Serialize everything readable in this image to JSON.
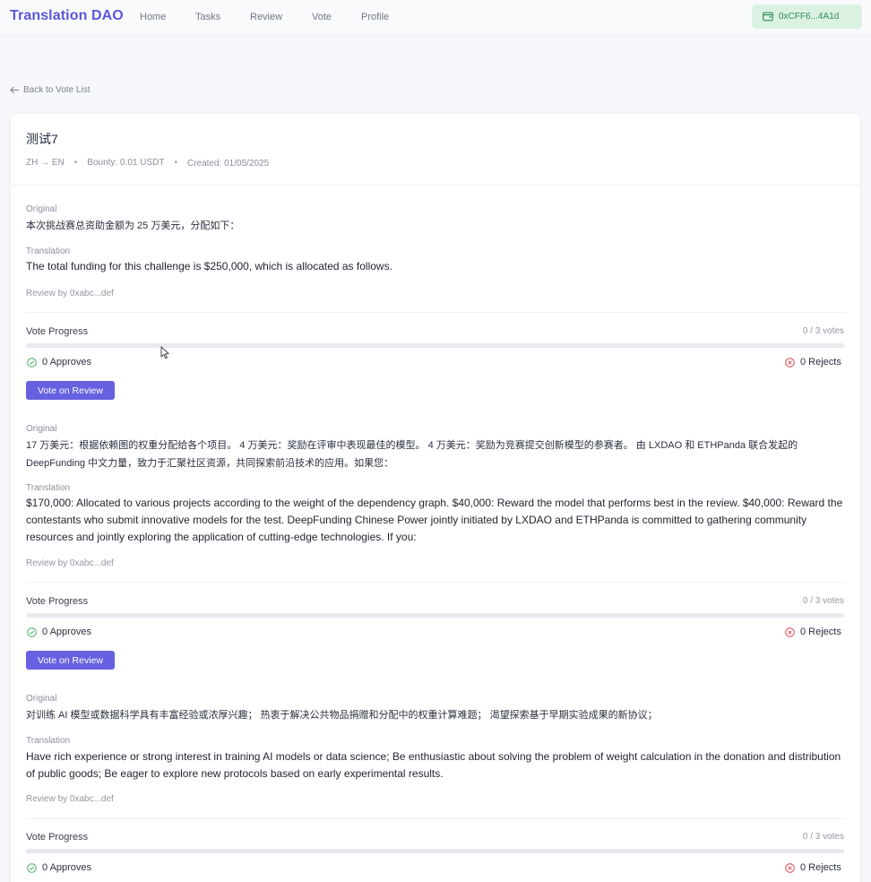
{
  "app": {
    "brand": "Translation DAO",
    "nav": [
      "Home",
      "Tasks",
      "Review",
      "Vote",
      "Profile"
    ],
    "wallet": "0xCFF6...4A1d",
    "wallet_icon": "wallet-icon",
    "colors": {
      "brand": "#5b57d9",
      "wallet_bg": "#dbf2e3",
      "wallet_text": "#2f8a53",
      "button": "#6661e0",
      "approve": "#4caf6e",
      "reject": "#e04a5a"
    }
  },
  "back": {
    "label": "Back to Vote List",
    "icon": "arrow-left-icon"
  },
  "task": {
    "title": "测试7",
    "lang": "ZH → EN",
    "bounty": "Bounty: 0.01 USDT",
    "created": "Created: 01/05/2025"
  },
  "labels": {
    "original": "Original",
    "translation": "Translation",
    "vote_progress": "Vote Progress",
    "vote_button": "Vote on Review"
  },
  "reviews": [
    {
      "original": "本次挑战赛总资助金额为 25 万美元，分配如下：",
      "translation": "The total funding for this challenge is $250,000, which is allocated as follows.",
      "reviewer": "Review by 0xabc...def",
      "votes": "0 / 3 votes",
      "progress": 0,
      "approves": "0 Approves",
      "rejects": "0 Rejects"
    },
    {
      "original": "17 万美元：根据依赖图的权重分配给各个项目。 4 万美元：奖励在评审中表现最佳的模型。 4 万美元：奖励为竞赛提交创新模型的参赛者。 由 LXDAO 和 ETHPanda 联合发起的 DeepFunding 中文力量，致力于汇聚社区资源，共同探索前沿技术的应用。如果您：",
      "translation": "$170,000: Allocated to various projects according to the weight of the dependency graph. $40,000: Reward the model that performs best in the review. $40,000: Reward the contestants who submit innovative models for the test. DeepFunding Chinese Power jointly initiated by LXDAO and ETHPanda is committed to gathering community resources and jointly exploring the application of cutting-edge technologies. If you:",
      "reviewer": "Review by 0xabc...def",
      "votes": "0 / 3 votes",
      "progress": 0,
      "approves": "0 Approves",
      "rejects": "0 Rejects"
    },
    {
      "original": "对训练 AI 模型或数据科学具有丰富经验或浓厚兴趣； 热衷于解决公共物品捐赠和分配中的权重计算难题； 渴望探索基于早期实验成果的新协议；",
      "translation": "Have rich experience or strong interest in training AI models or data science; Be enthusiastic about solving the problem of weight calculation in the donation and distribution of public goods; Be eager to explore new protocols based on early experimental results.",
      "reviewer": "Review by 0xabc...def",
      "votes": "0 / 3 votes",
      "progress": 0,
      "approves": "0 Approves",
      "rejects": "0 Rejects"
    }
  ]
}
